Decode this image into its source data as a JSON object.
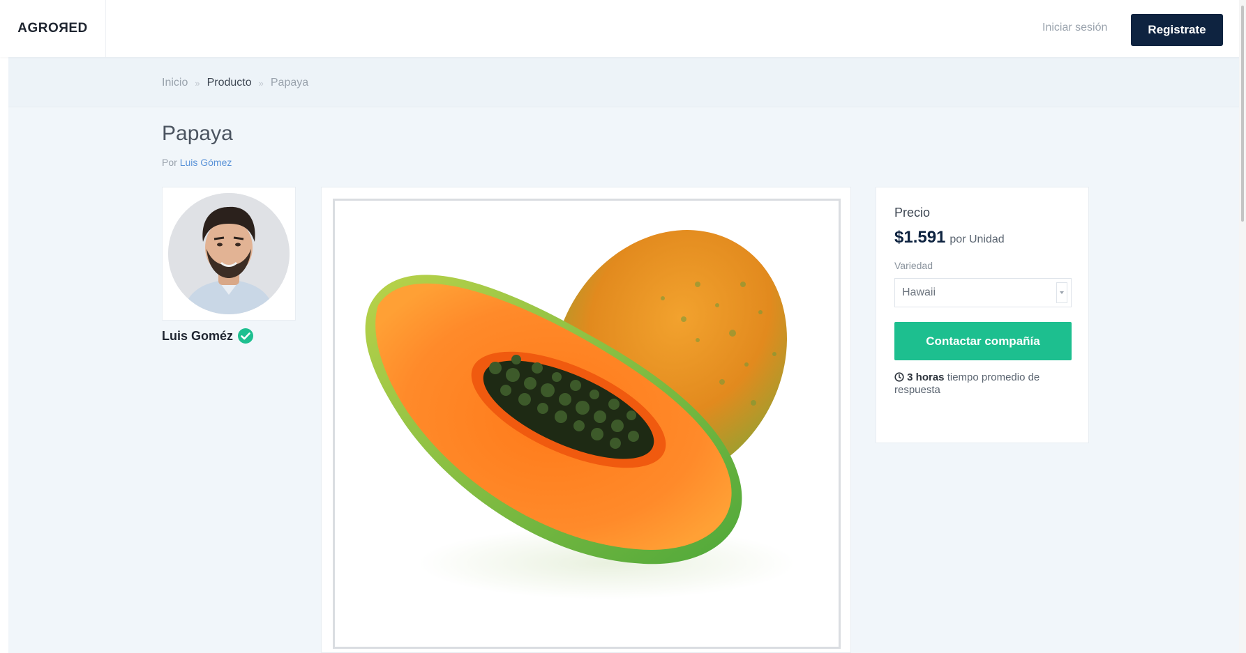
{
  "header": {
    "logo": "AGROЯED",
    "login_label": "Iniciar sesión",
    "register_label": "Registrate"
  },
  "breadcrumb": {
    "items": [
      "Inicio",
      "Producto",
      "Papaya"
    ],
    "separator": "»"
  },
  "product": {
    "title": "Papaya",
    "by_prefix": "Por",
    "seller_link": "Luis Gómez"
  },
  "seller": {
    "name": "Luis Goméz",
    "verified_icon": "check-circle-icon"
  },
  "pricing": {
    "label": "Precio",
    "value": "$1.591",
    "unit": "por Unidad",
    "variety_label": "Variedad",
    "variety_selected": "Hawaii",
    "contact_label": "Contactar compañía",
    "response_time": "3 horas",
    "response_text": "tiempo promedio de respuesta"
  },
  "colors": {
    "brand_navy": "#0e2340",
    "accent_green": "#1dbf8f",
    "link_blue": "#5a93d8"
  }
}
